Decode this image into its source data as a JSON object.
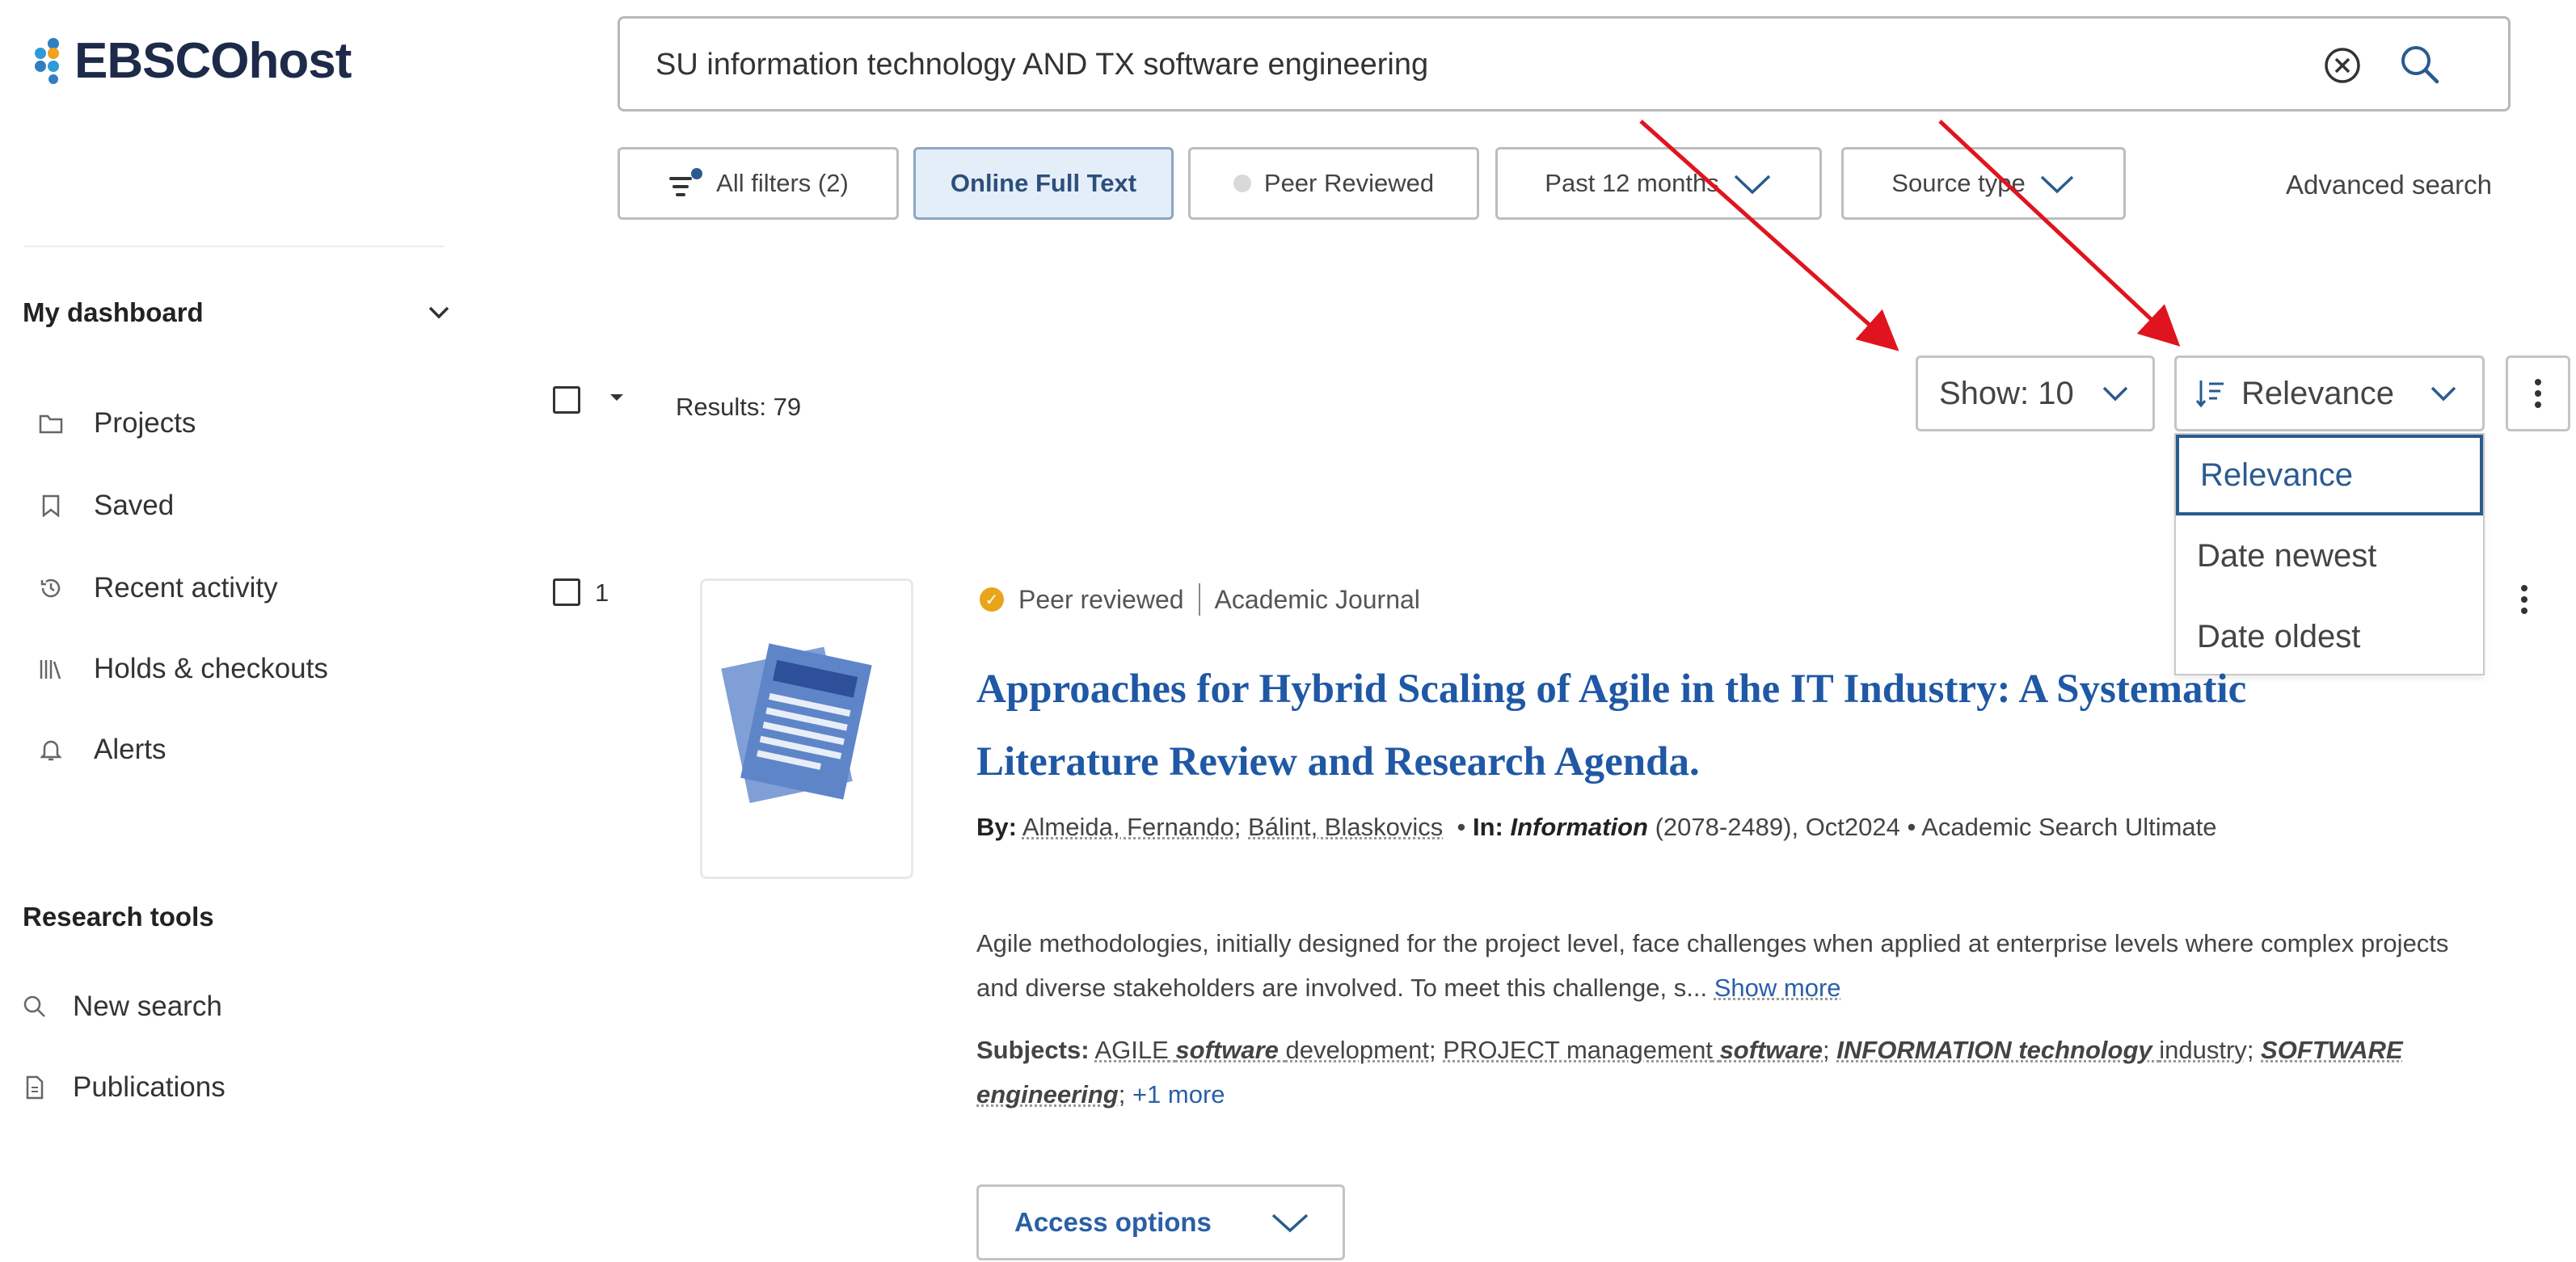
{
  "logo": {
    "text": "EBSCOhost"
  },
  "search": {
    "query": "SU information technology AND TX software engineering",
    "clear_icon": "circle-x-icon",
    "search_icon": "search-icon"
  },
  "filters": {
    "all_filters": "All filters (2)",
    "online_full_text": "Online Full Text",
    "peer_reviewed": "Peer Reviewed",
    "date": "Past 12 months",
    "source_type": "Source type",
    "advanced_search": "Advanced search"
  },
  "sidebar": {
    "dashboard_heading": "My dashboard",
    "dashboard_items": [
      {
        "label": "Projects",
        "icon": "folder-icon"
      },
      {
        "label": "Saved",
        "icon": "bookmark-icon"
      },
      {
        "label": "Recent activity",
        "icon": "history-icon"
      },
      {
        "label": "Holds & checkouts",
        "icon": "books-icon"
      },
      {
        "label": "Alerts",
        "icon": "bell-icon"
      }
    ],
    "tools_heading": "Research tools",
    "tools_items": [
      {
        "label": "New search",
        "icon": "search-icon"
      },
      {
        "label": "Publications",
        "icon": "document-icon"
      }
    ]
  },
  "results_bar": {
    "count": "Results: 79",
    "show": "Show: 10",
    "sort": "Relevance",
    "sort_options": [
      "Relevance",
      "Date newest",
      "Date oldest"
    ]
  },
  "result": {
    "number": "1",
    "peer_reviewed": "Peer reviewed",
    "type": "Academic Journal",
    "title": "Approaches for Hybrid Scaling of Agile in the IT Industry: A Systematic Literature Review and Research Agenda.",
    "by_label": "By:",
    "author1": "Almeida, Fernando",
    "author2": "Bálint, Blaskovics",
    "in_label": "In:",
    "journal": "Information",
    "journal_info": "(2078-2489), Oct2024 • Academic Search Ultimate",
    "abstract": "Agile methodologies, initially designed for the project level, face challenges when applied at enterprise levels where complex projects and diverse stakeholders are involved. To meet this challenge, s...",
    "show_more": "Show more",
    "subjects_label": "Subjects:",
    "subject1_a": "AGILE",
    "subject1_b": "software",
    "subject1_c": "development",
    "subject2_a": "PROJECT management",
    "subject2_b": "software",
    "subject3_a": "INFORMATION technology",
    "subject3_b": "industry",
    "subject4": "SOFTWARE engineering",
    "more": "+1 more",
    "access": "Access options"
  },
  "colors": {
    "accent": "#2a5b8f",
    "title": "#1f58a5",
    "annotation_arrow": "#e0141e",
    "badge": "#e9a41a"
  }
}
